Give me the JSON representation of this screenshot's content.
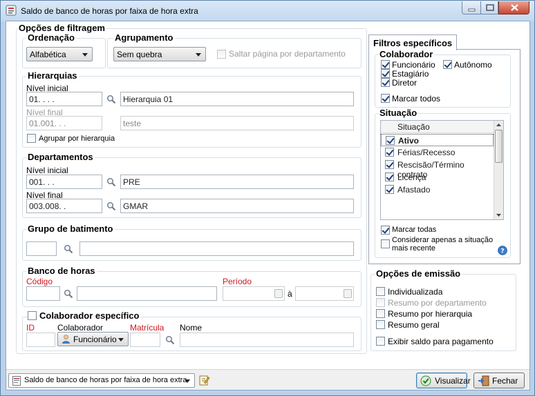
{
  "window": {
    "title": "Saldo de banco de horas por faixa de hora extra"
  },
  "filters": {
    "legend": "Opções de filtragem",
    "ordenacao": {
      "legend": "Ordenação",
      "value": "Alfabética"
    },
    "agrupamento": {
      "legend": "Agrupamento",
      "value": "Sem quebra",
      "saltar_label": "Saltar página por departamento"
    },
    "hierarquias": {
      "legend": "Hierarquias",
      "nivel_inicial_label": "Nível inicial",
      "nivel_inicial_code": "01.   .   .   .",
      "nivel_inicial_desc": "Hierarquia 01",
      "nivel_final_label": "Nível final",
      "nivel_final_code": "01.001.   .   .",
      "nivel_final_desc": "teste",
      "agrupar_label": "Agrupar por hierarquia"
    },
    "departamentos": {
      "legend": "Departamentos",
      "nivel_inicial_label": "Nível inicial",
      "nivel_inicial_code": "001.   .   .",
      "nivel_inicial_desc": "PRE",
      "nivel_final_label": "Nível final",
      "nivel_final_code": "003.008.   .",
      "nivel_final_desc": "GMAR"
    },
    "grupo_batimento": {
      "legend": "Grupo de batimento"
    },
    "banco_horas": {
      "legend": "Banco de horas",
      "codigo_label": "Código",
      "periodo_label": "Período",
      "ate_label": "à"
    },
    "colaborador_especifico": {
      "legend": "Colaborador específico",
      "id_label": "ID",
      "colaborador_label": "Colaborador",
      "colaborador_value": "Funcionário",
      "matricula_label": "Matrícula",
      "nome_label": "Nome"
    }
  },
  "specific": {
    "tab": "Filtros específicos",
    "colaborador": {
      "legend": "Colaborador",
      "funcionario": "Funcionário",
      "autonomo": "Autônomo",
      "estagiario": "Estagiário",
      "diretor": "Diretor",
      "marcar_todos": "Marcar todos"
    },
    "situacao": {
      "legend": "Situação",
      "header": "Situação",
      "rows": [
        "Ativo",
        "Férias/Recesso",
        "Rescisão/Término contrato",
        "Licença",
        "Afastado"
      ],
      "marcar_todas": "Marcar todas",
      "considerar_line1": "Considerar apenas a situação",
      "considerar_line2": "mais recente"
    }
  },
  "emissao": {
    "legend": "Opções de emissão",
    "individualizada": "Individualizada",
    "resumo_departamento": "Resumo por departamento",
    "resumo_hierarquia": "Resumo por hierarquia",
    "resumo_geral": "Resumo geral",
    "exibir_saldo": "Exibir saldo para pagamento"
  },
  "footer": {
    "report_select": "Saldo de banco de horas por faixa de hora extra",
    "visualizar": "Visualizar",
    "fechar": "Fechar"
  },
  "colors": {
    "accent_red": "#d0161e",
    "title_bar": "#c2d8ef",
    "border": "#d5dfe5"
  }
}
